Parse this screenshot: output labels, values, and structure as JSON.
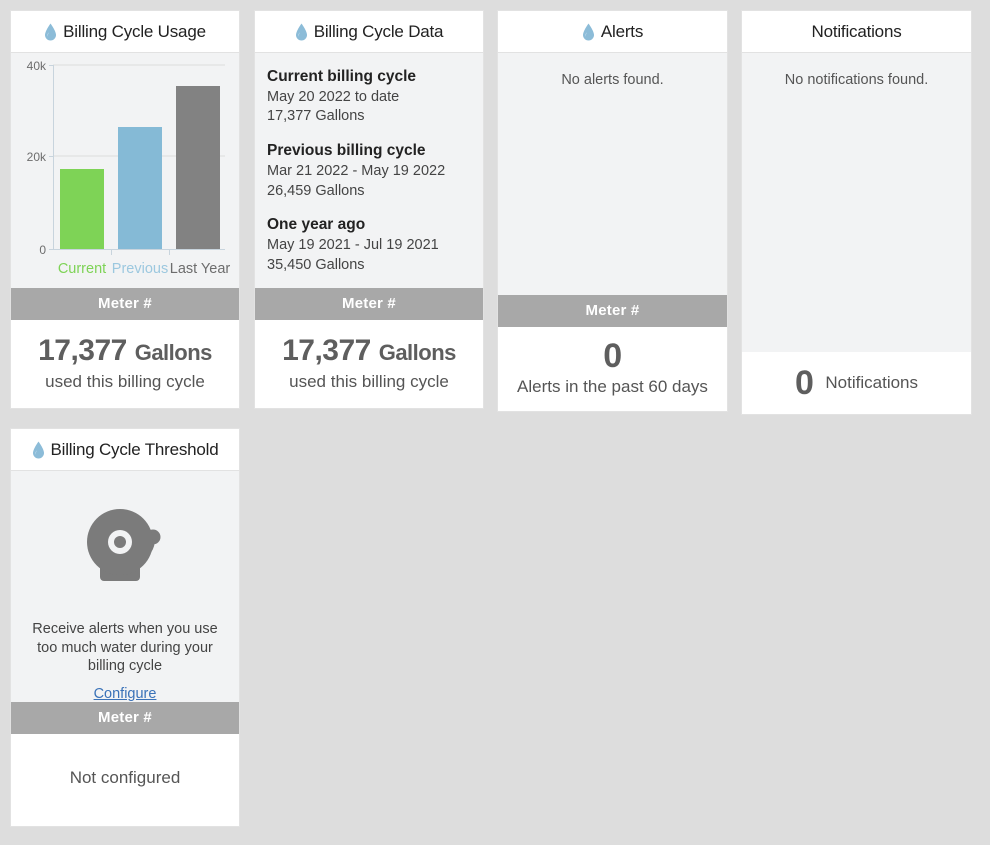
{
  "theme": {
    "page_background": "#dddddd",
    "card_background": "#ffffff",
    "card_body_background": "#f2f3f4",
    "meter_bar_background": "#a8a8a8",
    "current_color": "#7ed356",
    "previous_color": "#85bad6",
    "last_year_color": "#828282",
    "drop_icon_color": "#8cbcd8",
    "link_color": "#3a72b8",
    "value_text_color": "#5e5e5e"
  },
  "cards": {
    "usage": {
      "title": "Billing Cycle Usage",
      "icon": "water-drop-icon",
      "meter_label": "Meter #",
      "value": "17,377",
      "unit": "Gallons",
      "caption": "used this billing cycle"
    },
    "data": {
      "title": "Billing Cycle Data",
      "icon": "water-drop-icon",
      "meter_label": "Meter #",
      "value": "17,377",
      "unit": "Gallons",
      "caption": "used this billing cycle",
      "groups": [
        {
          "heading": "Current billing cycle",
          "range": "May 20 2022 to date",
          "amount": "17,377 Gallons"
        },
        {
          "heading": "Previous billing cycle",
          "range": "Mar 21 2022 - May 19 2022",
          "amount": "26,459 Gallons"
        },
        {
          "heading": "One year ago",
          "range": "May 19 2021 - Jul 19 2021",
          "amount": "35,450 Gallons"
        }
      ]
    },
    "alerts": {
      "title": "Alerts",
      "icon": "water-drop-icon",
      "empty_message": "No alerts found.",
      "meter_label": "Meter #",
      "count": "0",
      "caption": "Alerts in the past 60 days"
    },
    "notifications": {
      "title": "Notifications",
      "empty_message": "No notifications found.",
      "count": "0",
      "caption": "Notifications"
    },
    "threshold": {
      "title": "Billing Cycle Threshold",
      "icon": "water-drop-icon",
      "bell_icon": "alarm-bell-icon",
      "description": "Receive alerts when you use too much water during your billing cycle",
      "link_label": "Configure",
      "meter_label": "Meter #",
      "status": "Not configured"
    }
  },
  "chart_data": {
    "type": "bar",
    "title": "Billing Cycle Usage",
    "categories": [
      "Current",
      "Previous",
      "Last Year"
    ],
    "values": [
      17377,
      26459,
      35450
    ],
    "colors": [
      "#7ed356",
      "#85bad6",
      "#828282"
    ],
    "label_colors": [
      "#7ed356",
      "#9cc8df",
      "#6d6d6d"
    ],
    "xlabel": "",
    "ylabel": "",
    "ylim": [
      0,
      40000
    ],
    "yticks": [
      0,
      20000,
      40000
    ],
    "ytick_labels": [
      "0",
      "20k",
      "40k"
    ],
    "grid": true,
    "legend": false
  }
}
